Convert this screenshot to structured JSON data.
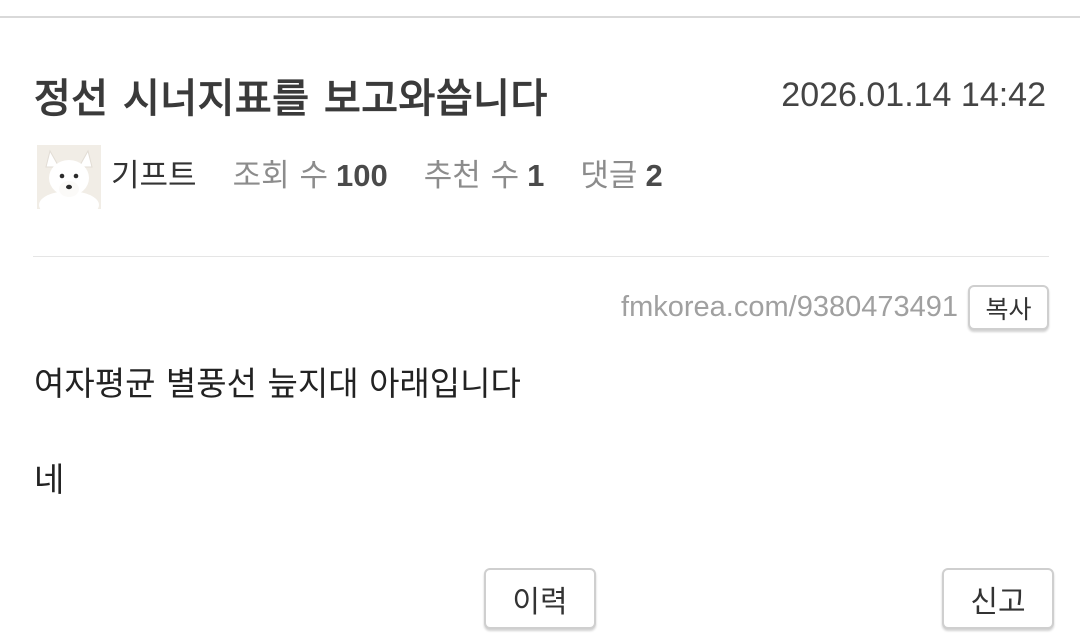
{
  "post": {
    "title": "정선 시너지표를 보고와씁니다",
    "date": "2026.01.14 14:42",
    "author": "기프트",
    "views_label": "조회 수",
    "views": "100",
    "recommends_label": "추천 수",
    "recommends": "1",
    "comments_label": "댓글",
    "comments": "2",
    "avatar_icon": "arctic-fox-avatar"
  },
  "url_bar": {
    "url": "fmkorea.com/9380473491",
    "copy_label": "복사"
  },
  "content": {
    "lines": [
      "여자평균 별풍선 늪지대 아래입니다",
      "네"
    ]
  },
  "actions": {
    "history_label": "이력",
    "report_label": "신고"
  }
}
